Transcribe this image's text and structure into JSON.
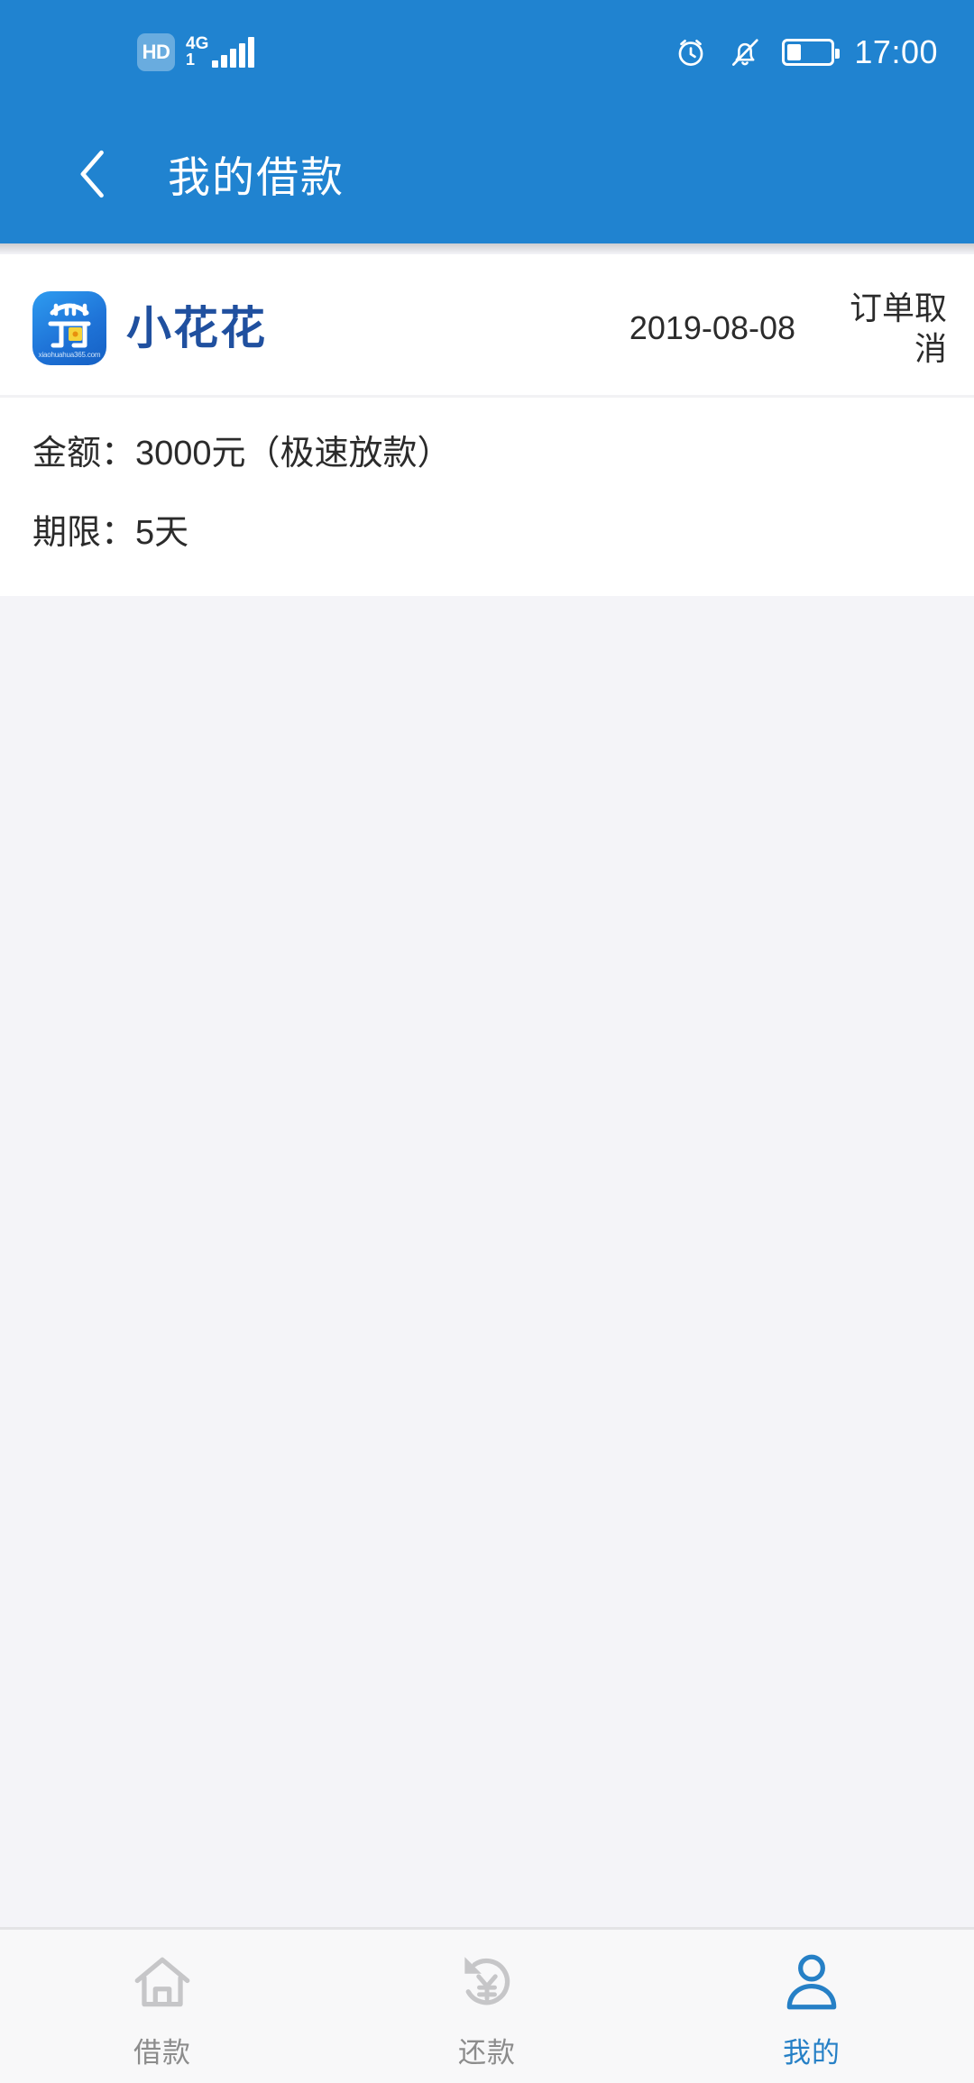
{
  "status_bar": {
    "hd_badge": "HD",
    "network_type": "4G",
    "network_sub": "1",
    "signal_icon": "signal-bars-icon",
    "alarm_icon": "alarm-clock-icon",
    "mute_icon": "bell-muted-icon",
    "battery_icon": "battery-icon",
    "battery_level_percent": 32,
    "time": "17:00"
  },
  "header": {
    "back_icon": "chevron-left-icon",
    "title": "我的借款",
    "background_color": "#2083D0"
  },
  "order_card": {
    "logo": {
      "icon_name": "xiaohuahua-app-icon",
      "brand_text": "小花花",
      "domain_text": "xiaohuahua365.com",
      "brand_color": "#20509F"
    },
    "date": "2019-08-08",
    "status": "订单取消",
    "details": [
      "金额：3000元（极速放款）",
      "期限：5天"
    ]
  },
  "tab_bar": {
    "active_color": "#2680C6",
    "inactive_color": "#8C8C8C",
    "tabs": [
      {
        "icon": "home-icon",
        "label": "借款",
        "active": false
      },
      {
        "icon": "repay-yen-refresh-icon",
        "label": "还款",
        "active": false
      },
      {
        "icon": "person-icon",
        "label": "我的",
        "active": true
      }
    ]
  }
}
